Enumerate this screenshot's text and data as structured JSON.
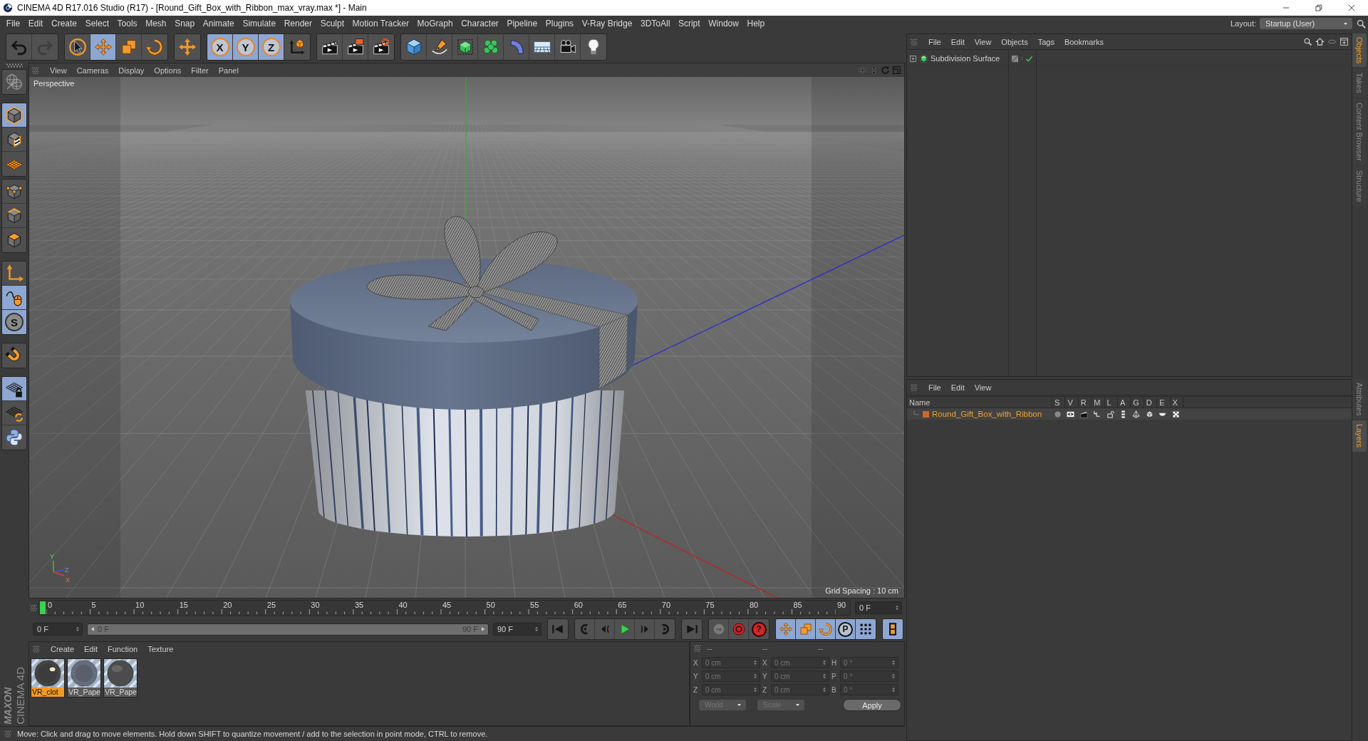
{
  "window": {
    "title": "CINEMA 4D R17.016 Studio (R17) - [Round_Gift_Box_with_Ribbon_max_vray.max *] - Main"
  },
  "menu_bar": [
    "File",
    "Edit",
    "Create",
    "Select",
    "Tools",
    "Mesh",
    "Snap",
    "Animate",
    "Simulate",
    "Render",
    "Sculpt",
    "Motion Tracker",
    "MoGraph",
    "Character",
    "Pipeline",
    "Plugins",
    "V-Ray Bridge",
    "3DToAll",
    "Script",
    "Window",
    "Help"
  ],
  "layout": {
    "label": "Layout:",
    "value": "Startup (User)"
  },
  "toolbar": [
    [
      {
        "selected": false,
        "disabled": false
      },
      {
        "selected": false,
        "disabled": true
      }
    ],
    [
      {
        "selected": false,
        "disabled": false
      },
      {
        "selected": true,
        "disabled": false
      },
      {
        "selected": false,
        "disabled": false
      },
      {
        "selected": false,
        "disabled": false
      }
    ],
    [
      {
        "selected": false,
        "disabled": false
      }
    ],
    [
      {
        "label": "X",
        "selected": true,
        "disabled": false
      },
      {
        "label": "Y",
        "selected": true,
        "disabled": false
      },
      {
        "label": "Z",
        "selected": true,
        "disabled": false
      },
      {
        "selected": false,
        "disabled": false
      }
    ],
    [
      {
        "selected": false,
        "disabled": false
      },
      {
        "selected": false,
        "disabled": false
      },
      {
        "selected": false,
        "disabled": false
      }
    ],
    [
      {
        "selected": false,
        "disabled": false
      },
      {
        "selected": false,
        "disabled": false
      },
      {
        "selected": false,
        "disabled": false
      },
      {
        "selected": false,
        "disabled": false
      },
      {
        "selected": false,
        "disabled": false
      },
      {
        "selected": false,
        "disabled": false
      },
      {
        "selected": false,
        "disabled": false
      },
      {
        "selected": false,
        "disabled": false
      }
    ]
  ],
  "tool_palette": [
    [
      {
        "selected": false
      }
    ],
    [
      {
        "selected": true
      },
      {
        "selected": false
      },
      {
        "selected": false
      }
    ],
    [
      {
        "selected": false
      },
      {
        "selected": false
      },
      {
        "selected": false
      }
    ],
    [
      {
        "selected": false
      },
      {
        "selected": true
      },
      {
        "label": "S",
        "selected": true
      }
    ],
    [
      {
        "selected": false
      }
    ],
    [
      {
        "selected": true
      },
      {
        "selected": false
      },
      {
        "selected": false
      }
    ]
  ],
  "viewport": {
    "menu": [
      "View",
      "Cameras",
      "Display",
      "Options",
      "Filter",
      "Panel"
    ],
    "camera": "Perspective",
    "grid_spacing": "Grid Spacing : 10 cm",
    "axis_labels": [
      "Y",
      "Z",
      "X"
    ]
  },
  "timeline": {
    "ticks": [
      "0",
      "5",
      "10",
      "15",
      "20",
      "25",
      "30",
      "35",
      "40",
      "45",
      "50",
      "55",
      "60",
      "65",
      "70",
      "75",
      "80",
      "85",
      "90"
    ],
    "level": 0,
    "current_frame": "0 F"
  },
  "playback": {
    "start_frame": "0 F",
    "range": {
      "start": "0 F",
      "end": "90 F"
    },
    "end_frame": "90 F",
    "controls": [
      [
        {
          "selected": false
        }
      ],
      [
        {
          "selected": false
        },
        {
          "selected": false
        },
        {
          "selected": false
        },
        {
          "selected": false
        },
        {
          "selected": false
        }
      ],
      [
        {
          "selected": false
        }
      ],
      [
        {
          "selected": false
        },
        {
          "selected": false
        },
        {
          "label": "?",
          "selected": false
        }
      ],
      [
        {
          "selected": true
        },
        {
          "selected": true
        },
        {
          "selected": true
        },
        {
          "label": "P",
          "selected": true
        },
        {
          "selected": true
        }
      ],
      [
        {
          "selected": true
        }
      ]
    ]
  },
  "materials": {
    "menu": [
      "Create",
      "Edit",
      "Function",
      "Texture"
    ],
    "items": [
      {
        "name": "VR_clot",
        "selected": true
      },
      {
        "name": "VR_Pape",
        "selected": false
      },
      {
        "name": "VR_Pape",
        "selected": false
      }
    ]
  },
  "coordinates": {
    "disabled": true,
    "headers": [
      "--",
      "--",
      "--"
    ],
    "rows": [
      {
        "position_axis": "X",
        "position": "0 cm",
        "size_axis": "X",
        "size": "0 cm",
        "rotation_axis": "H",
        "rotation": "0 °"
      },
      {
        "position_axis": "Y",
        "position": "0 cm",
        "size_axis": "Y",
        "size": "0 cm",
        "rotation_axis": "P",
        "rotation": "0 °"
      },
      {
        "position_axis": "Z",
        "position": "0 cm",
        "size_axis": "Z",
        "size": "0 cm",
        "rotation_axis": "B",
        "rotation": "0 °"
      }
    ],
    "coordinate_system": "World",
    "transform_mode": "Scale",
    "apply": "Apply"
  },
  "objects_panel": {
    "menu": [
      "File",
      "Edit",
      "View",
      "Objects",
      "Tags",
      "Bookmarks"
    ],
    "objects": [
      {
        "name": "Subdivision Surface",
        "expanded": false,
        "enabled": true
      }
    ]
  },
  "layers_panel": {
    "menu": [
      "File",
      "Edit",
      "View"
    ],
    "columns": [
      "Name",
      "S",
      "V",
      "R",
      "M",
      "L",
      "A",
      "G",
      "D",
      "E",
      "X"
    ],
    "layers": [
      {
        "name": "Round_Gift_Box_with_Ribbon",
        "color": "#d0662c"
      }
    ]
  },
  "side_tabs": {
    "top": [
      {
        "label": "Objects",
        "selected": true
      },
      {
        "label": "Takes",
        "selected": false
      },
      {
        "label": "Content Browser",
        "selected": false
      },
      {
        "label": "Structure",
        "selected": false
      }
    ],
    "bottom": [
      {
        "label": "Attributes",
        "selected": false
      },
      {
        "label": "Layers",
        "selected": true
      }
    ]
  },
  "branding": {
    "company": "MAXON",
    "product": "CINEMA 4D"
  },
  "status_bar": "Move: Click and drag to move elements. Hold down SHIFT to quantize movement / add to the selection in point mode, CTRL to remove."
}
